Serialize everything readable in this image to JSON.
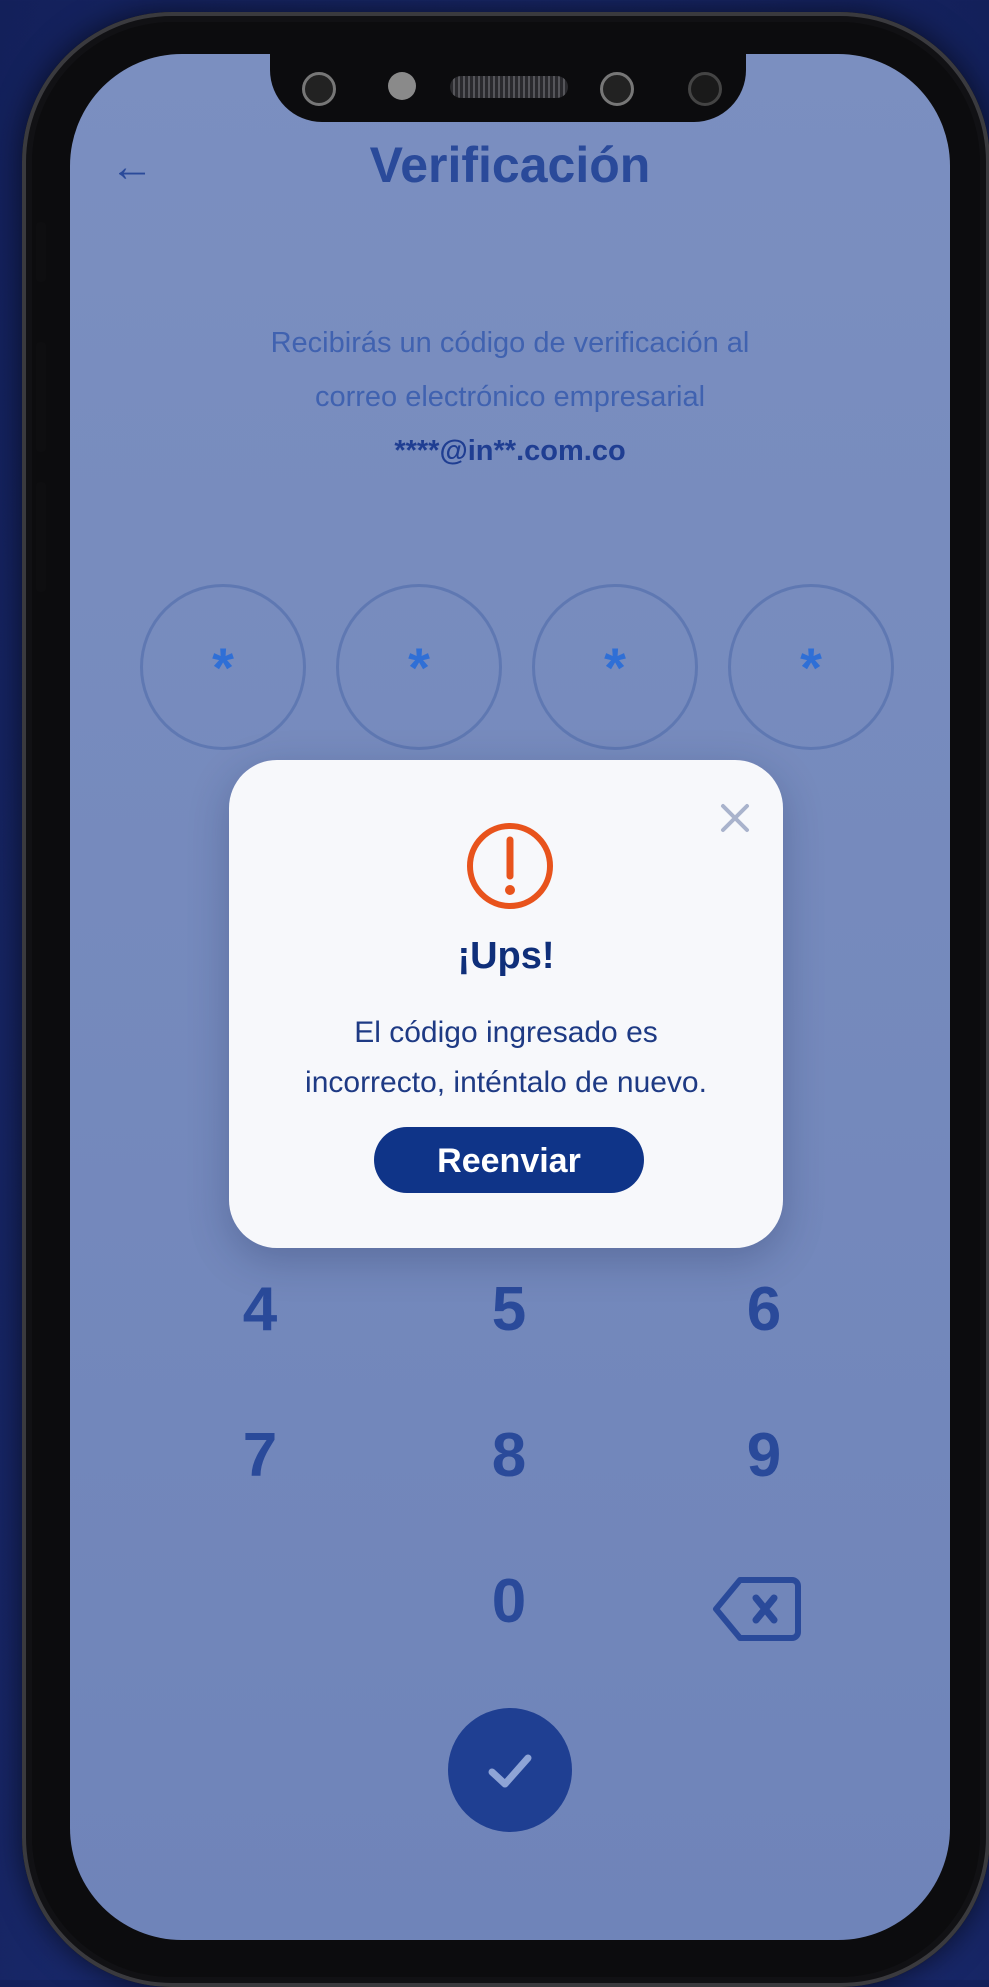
{
  "screen": {
    "title": "Verificación",
    "description_line1": "Recibirás un código de verificación al",
    "description_line2": "correo electrónico empresarial",
    "masked_email": "****@in**.com.co",
    "pin_digits": [
      "*",
      "*",
      "*",
      "*"
    ],
    "keypad": {
      "row2": [
        "4",
        "5",
        "6"
      ],
      "row3": [
        "7",
        "8",
        "9"
      ],
      "zero": "0"
    },
    "icons": {
      "back": "arrow-left-icon",
      "backspace": "backspace-icon",
      "confirm": "check-icon"
    }
  },
  "modal": {
    "title": "¡Ups!",
    "message_line1": "El código ingresado es",
    "message_line2": "incorrecto, inténtalo de nuevo.",
    "button_label": "Reenviar",
    "icons": {
      "close": "close-icon",
      "warning": "exclamation-circle-icon"
    }
  },
  "colors": {
    "primary": "#0f3488",
    "warning": "#e8531c",
    "overlay_screen": "#7b8fc0"
  }
}
